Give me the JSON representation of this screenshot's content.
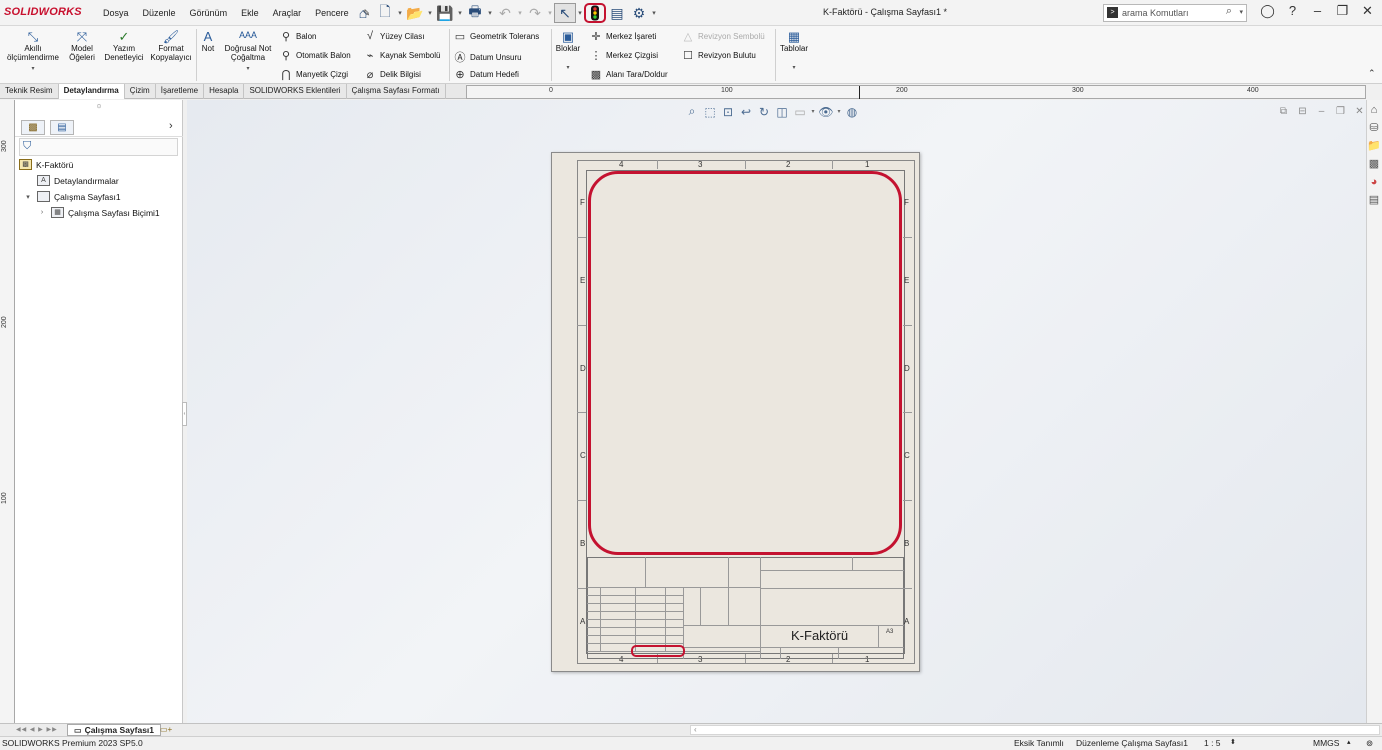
{
  "app": {
    "logo": "SOLIDWORKS",
    "doc_title": "K-Faktörü - Çalışma Sayfası1 *"
  },
  "menus": [
    "Dosya",
    "Düzenle",
    "Görünüm",
    "Ekle",
    "Araçlar",
    "Pencere"
  ],
  "search": {
    "placeholder": "arama Komutları"
  },
  "ribbon": {
    "smart_dimension": "Akıllı ölçümlendirme",
    "model_items": "Model Öğeleri",
    "spell_checker": "Yazım Denetleyici",
    "format_painter": "Format Kopyalayıcı",
    "note": "Not",
    "linear_note_pattern": "Doğrusal Not Çoğaltma",
    "balloon": "Balon",
    "auto_balloon": "Otomatik Balon",
    "magnetic_line": "Manyetik Çizgi",
    "surface_finish": "Yüzey Cilası",
    "weld_symbol": "Kaynak Sembolü",
    "hole_callout": "Delik Bilgisi",
    "geometric_tolerance": "Geometrik Tolerans",
    "datum_feature": "Datum Unsuru",
    "datum_target": "Datum Hedefi",
    "blocks": "Bloklar",
    "center_mark": "Merkez İşareti",
    "centerline": "Merkez Çizgisi",
    "area_hatch": "Alanı Tara/Doldur",
    "revision_symbol": "Revizyon Sembolü",
    "revision_cloud": "Revizyon Bulutu",
    "tables": "Tablolar"
  },
  "tabs": [
    {
      "label": "Teknik Resim",
      "active": false
    },
    {
      "label": "Detaylandırma",
      "active": true
    },
    {
      "label": "Çizim",
      "active": false
    },
    {
      "label": "İşaretleme",
      "active": false
    },
    {
      "label": "Hesapla",
      "active": false
    },
    {
      "label": "SOLIDWORKS Eklentileri",
      "active": false
    },
    {
      "label": "Çalışma Sayfası Formatı",
      "active": false
    }
  ],
  "ruler_h": {
    "labels": [
      "0",
      "100",
      "200",
      "300",
      "400"
    ]
  },
  "ruler_v": {
    "labels": [
      "300",
      "200",
      "100"
    ]
  },
  "tree": {
    "root": "K-Faktörü",
    "annotations": "Detaylandırmalar",
    "sheet": "Çalışma Sayfası1",
    "sheet_format": "Çalışma Sayfası Biçimi1"
  },
  "sheet": {
    "zones_cols": [
      "4",
      "3",
      "2",
      "1"
    ],
    "zones_rows": [
      "F",
      "E",
      "D",
      "C",
      "B",
      "A"
    ],
    "title_name": "K-Faktörü",
    "size": "A3"
  },
  "sheet_tabs": {
    "active": "Çalışma Sayfası1"
  },
  "status": {
    "version": "SOLIDWORKS Premium 2023 SP5.0",
    "definition": "Eksik Tanımlı",
    "mode": "Düzenleme Çalışma Sayfası1",
    "scale": "1 : 5",
    "units": "MMGS"
  },
  "colors": {
    "highlight": "#c41230",
    "brand": "#c8102e"
  }
}
